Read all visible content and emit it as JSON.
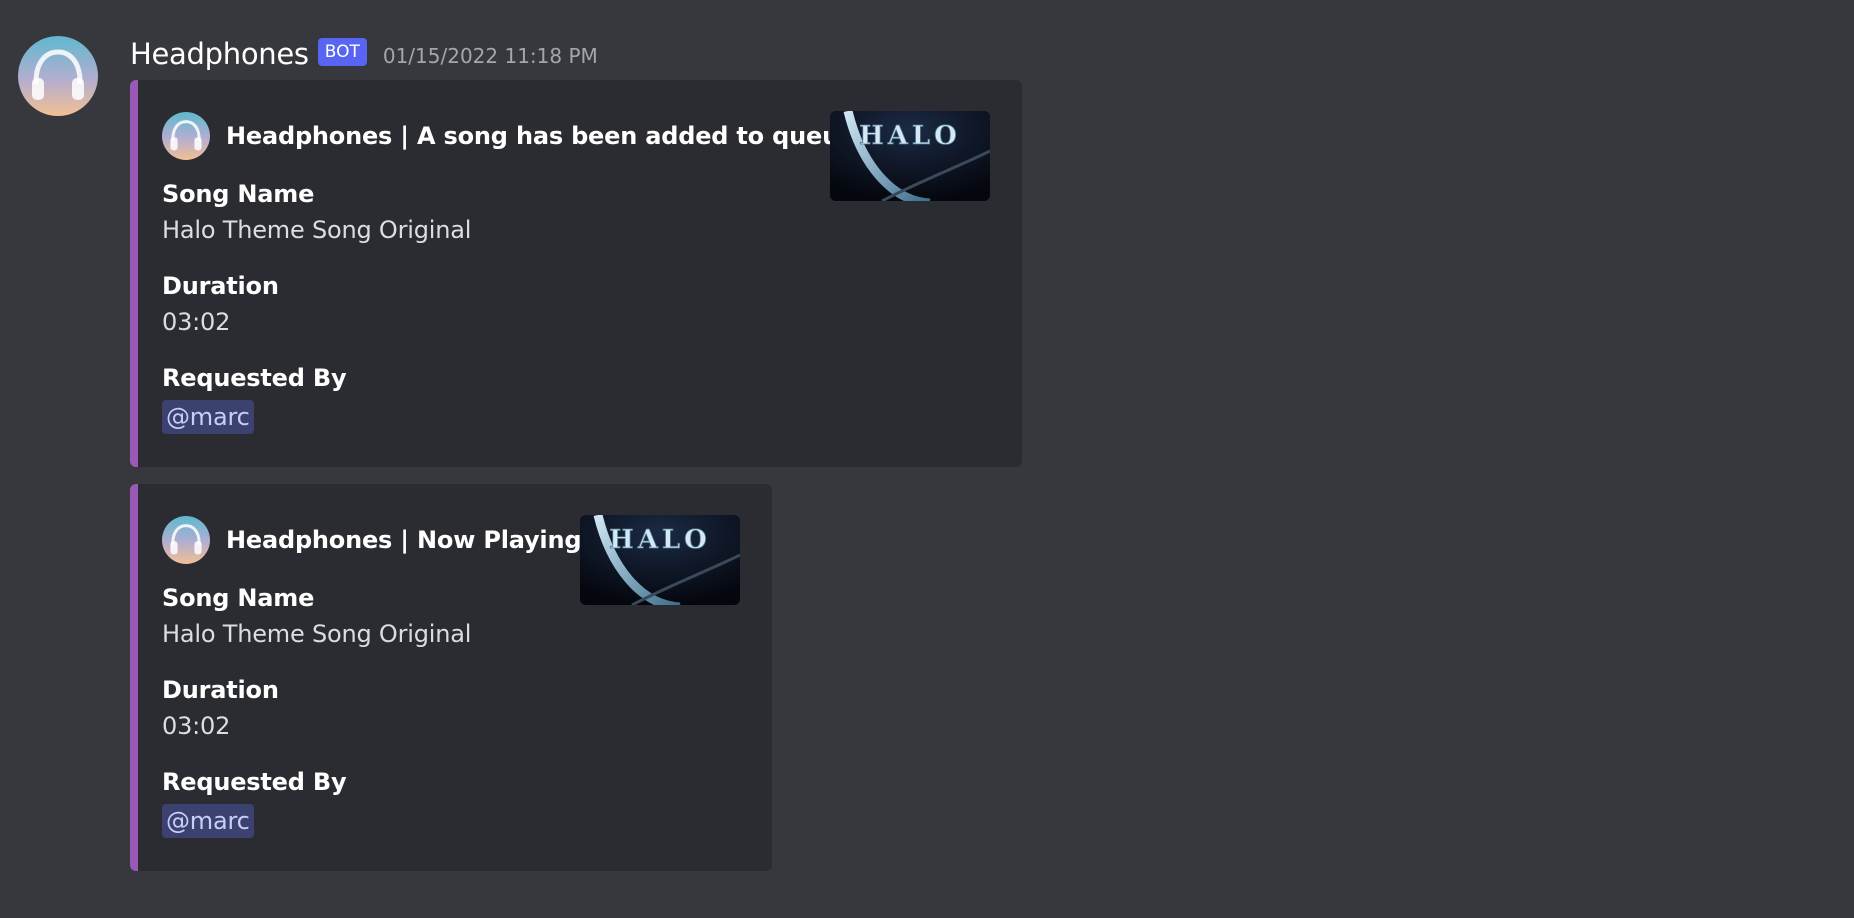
{
  "message": {
    "username": "Headphones",
    "badge": "BOT",
    "timestamp": "01/15/2022 11:18 PM",
    "avatar_icon": "headphones-icon",
    "accent_color": "#9b59b6"
  },
  "embeds": [
    {
      "author": "Headphones | A song has been added to queue!",
      "thumbnail_text": "HALO",
      "fields": [
        {
          "name": "Song Name",
          "value": "Halo Theme Song Original"
        },
        {
          "name": "Duration",
          "value": "03:02"
        },
        {
          "name": "Requested By",
          "value": "@marc"
        }
      ]
    },
    {
      "author": "Headphones | Now Playing",
      "thumbnail_text": "HALO",
      "fields": [
        {
          "name": "Song Name",
          "value": "Halo Theme Song Original"
        },
        {
          "name": "Duration",
          "value": "03:02"
        },
        {
          "name": "Requested By",
          "value": "@marc"
        }
      ]
    }
  ]
}
